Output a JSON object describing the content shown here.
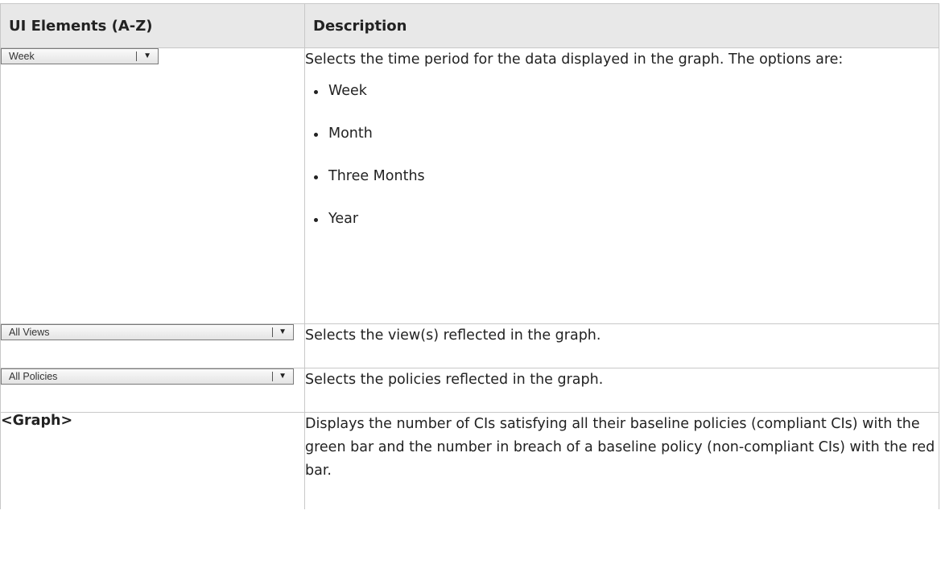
{
  "table": {
    "header_col1": "UI Elements (A-Z)",
    "header_col2": "Description",
    "rows": [
      {
        "element": {
          "type": "dropdown",
          "value": "Week"
        },
        "description": "Selects the time period for the data displayed in the graph. The options are:",
        "options": [
          "Week",
          "Month",
          "Three Months",
          "Year"
        ]
      },
      {
        "element": {
          "type": "dropdown",
          "value": "All Views"
        },
        "description": "Selects the view(s) reflected in the graph."
      },
      {
        "element": {
          "type": "dropdown",
          "value": "All Policies"
        },
        "description": "Selects the policies reflected in the graph."
      },
      {
        "element": {
          "type": "label",
          "value": "<Graph>"
        },
        "description": "Displays the number of CIs satisfying all their baseline policies (compliant CIs) with the green bar and the number in breach of a baseline policy (non-compliant CIs) with the red bar."
      }
    ]
  },
  "icons": {
    "dropdown_arrow": "▼"
  }
}
